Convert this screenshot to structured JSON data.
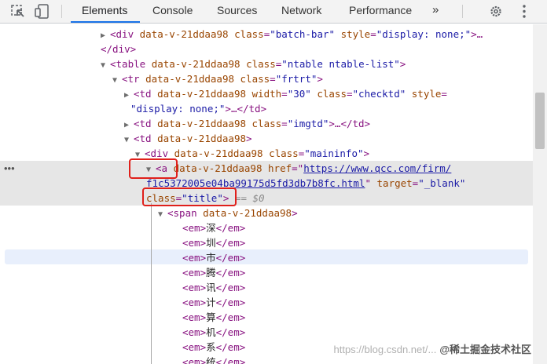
{
  "toolbar": {
    "tabs": [
      "Elements",
      "Console",
      "Sources",
      "Network",
      "Performance"
    ],
    "more": "»",
    "icons": [
      "inspect-icon",
      "device-toggle-icon",
      "settings-icon",
      "more-vert-icon"
    ]
  },
  "lines": {
    "l1": {
      "open": "<div",
      "a1": "data-v-21ddaa98",
      "a2": "class",
      "v2": "\"batch-bar\"",
      "a3": "style",
      "v3": "\"display: none;\"",
      "end": ">…"
    },
    "l2": {
      "close": "</div>"
    },
    "l3": {
      "open": "<table",
      "a1": "data-v-21ddaa98",
      "a2": "class",
      "v2": "\"ntable ntable-list\"",
      "end": ">"
    },
    "l4": {
      "open": "<tr",
      "a1": "data-v-21ddaa98",
      "a2": "class",
      "v2": "\"frtrt\"",
      "end": ">"
    },
    "l5": {
      "open": "<td",
      "a1": "data-v-21ddaa98",
      "a2": "width",
      "v2": "\"30\"",
      "a3": "class",
      "v3": "\"checktd\"",
      "a4": "style",
      "v4a": "="
    },
    "l6": {
      "v4b": "\"display: none;\"",
      "end": ">…</td>"
    },
    "l7": {
      "open": "<td",
      "a1": "data-v-21ddaa98",
      "a2": "class",
      "v2": "\"imgtd\"",
      "end": ">…</td>"
    },
    "l8": {
      "open": "<td",
      "a1": "data-v-21ddaa98",
      "end": ">"
    },
    "l9": {
      "open": "<div",
      "a1": "data-v-21ddaa98",
      "a2": "class",
      "v2": "\"maininfo\"",
      "end": ">"
    },
    "l10": {
      "open": "<a",
      "a1": "data-v-21ddaa98",
      "a2": "href",
      "href1": "https://www.qcc.com/firm/"
    },
    "l11": {
      "href2": "f1c5372005e04ba99175d5fd3db7b8fc.html",
      "a3": "target",
      "v3": "\"_blank\""
    },
    "l12": {
      "a4": "class",
      "v4": "\"title\"",
      "end": ">",
      "eq": "== $0"
    },
    "l13": {
      "open": "<span",
      "a1": "data-v-21ddaa98",
      "end": ">"
    }
  },
  "ems": [
    "深",
    "圳",
    "市",
    "腾",
    "讯",
    "计",
    "算",
    "机",
    "系",
    "统"
  ],
  "em_tag": {
    "open": "<em>",
    "close": "</em>"
  },
  "watermark": {
    "url": "https://blog.csdn.net/...",
    "brand": "@稀土掘金技术社区"
  }
}
